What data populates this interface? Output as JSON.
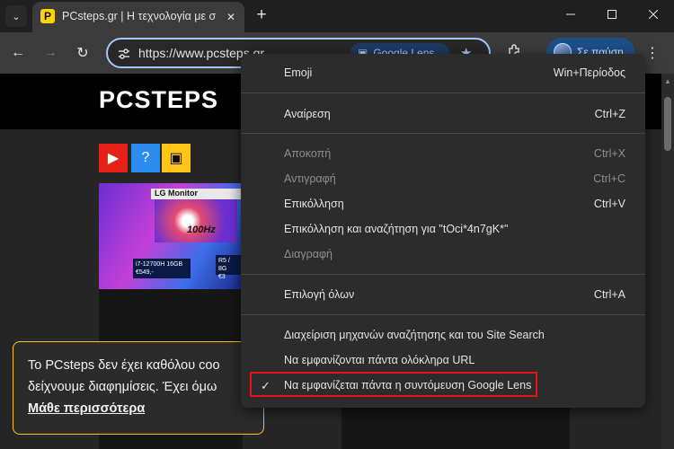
{
  "tab": {
    "favicon_letter": "P",
    "title": "PCsteps.gr | Η τεχνολογία με σ..."
  },
  "toolbar": {
    "url": "https://www.pcsteps.gr",
    "lens_chip": "Google Lens",
    "profile_label": "Σε παύση"
  },
  "page": {
    "logo": "PCSTEPS",
    "banner": {
      "monitor": "LG Monitor",
      "hz": "100Hz",
      "spec1_line1": "i7-12700H 16GB",
      "spec1_line2": "€549,-",
      "spec2_line1": "R5 / 8G",
      "spec2_line2": "€3"
    },
    "cookie": {
      "line1": "Το PCsteps δεν έχει καθόλου coo",
      "line2": "δείχνουμε διαφημίσεις. Έχει όμω",
      "link": "Μάθε περισσότερα"
    }
  },
  "menu": {
    "items": [
      {
        "label": "Emoji",
        "shortcut": "Win+Περίοδος",
        "disabled": false
      },
      {
        "label": "Αναίρεση",
        "shortcut": "Ctrl+Z",
        "disabled": false
      },
      {
        "label": "Αποκοπή",
        "shortcut": "Ctrl+X",
        "disabled": true
      },
      {
        "label": "Αντιγραφή",
        "shortcut": "Ctrl+C",
        "disabled": true
      },
      {
        "label": "Επικόλληση",
        "shortcut": "Ctrl+V",
        "disabled": false
      },
      {
        "label": "Επικόλληση και αναζήτηση για \"tOci*4n7gK*\"",
        "shortcut": "",
        "disabled": false
      },
      {
        "label": "Διαγραφή",
        "shortcut": "",
        "disabled": true
      },
      {
        "label": "Επιλογή όλων",
        "shortcut": "Ctrl+A",
        "disabled": false
      },
      {
        "label": "Διαχείριση μηχανών αναζήτησης και του Site Search",
        "shortcut": "",
        "disabled": false
      },
      {
        "label": "Να εμφανίζονται πάντα ολόκληρα URL",
        "shortcut": "",
        "disabled": false
      },
      {
        "label": "Να εμφανίζεται πάντα η συντόμευση Google Lens",
        "shortcut": "",
        "disabled": false,
        "checked": true
      }
    ]
  },
  "colors": {
    "highlight_border": "#e8101a",
    "omnibox_focus": "#a8c7fa",
    "cookie_border": "#ffc41a",
    "brand_yellow": "#ffd400"
  }
}
